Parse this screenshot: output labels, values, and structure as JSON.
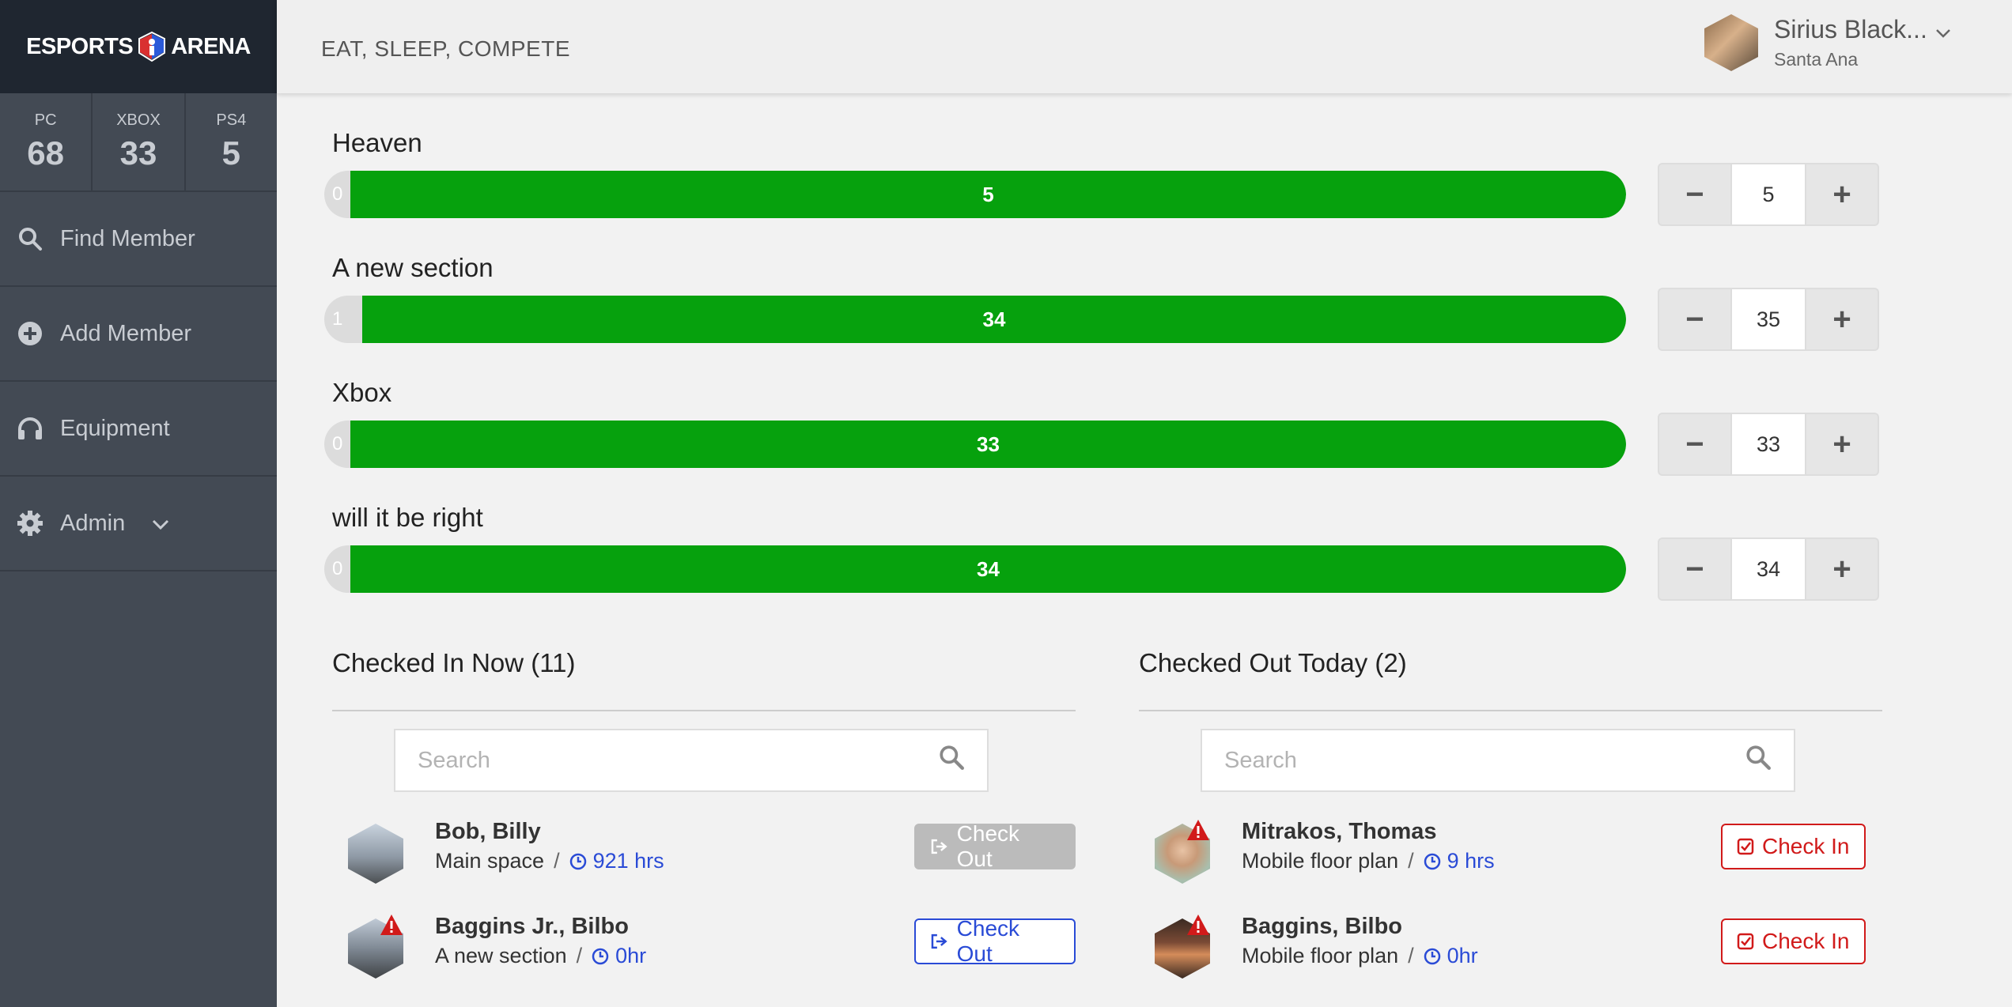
{
  "brand": {
    "left": "ESPORTS",
    "right": "ARENA"
  },
  "stats": [
    {
      "label": "PC",
      "value": "68"
    },
    {
      "label": "XBOX",
      "value": "33"
    },
    {
      "label": "PS4",
      "value": "5"
    }
  ],
  "nav": {
    "find": "Find Member",
    "add": "Add Member",
    "equipment": "Equipment",
    "admin": "Admin"
  },
  "header": {
    "tagline": "EAT, SLEEP, COMPETE",
    "user_name": "Sirius Black...",
    "user_location": "Santa Ana"
  },
  "sections": [
    {
      "title": "Heaven",
      "min": "0",
      "bar_value": "5",
      "count": "5",
      "fill_fraction": 0.98
    },
    {
      "title": "A new section",
      "min": "1",
      "bar_value": "34",
      "count": "35",
      "fill_fraction": 0.971
    },
    {
      "title": "Xbox",
      "min": "0",
      "bar_value": "33",
      "count": "33",
      "fill_fraction": 0.98
    },
    {
      "title": "will it be right",
      "min": "0",
      "bar_value": "34",
      "count": "34",
      "fill_fraction": 0.98
    }
  ],
  "stepper": {
    "minus": "−",
    "plus": "+"
  },
  "checked_in": {
    "title": "Checked In Now (11)",
    "search_placeholder": "Search",
    "rows": [
      {
        "name": "Bob, Billy",
        "location": "Main space",
        "hours": "921 hrs",
        "action": "Check Out"
      },
      {
        "name": "Baggins Jr., Bilbo",
        "location": "A new section",
        "hours": "0hr",
        "action": "Check Out"
      }
    ]
  },
  "checked_out": {
    "title": "Checked Out Today (2)",
    "search_placeholder": "Search",
    "rows": [
      {
        "name": "Mitrakos, Thomas",
        "location": "Mobile floor plan",
        "hours": "9 hrs",
        "action": "Check In"
      },
      {
        "name": "Baggins, Bilbo",
        "location": "Mobile floor plan",
        "hours": "0hr",
        "action": "Check In"
      }
    ]
  },
  "colors": {
    "bar_fill": "#06a10d",
    "sidebar": "#434a54",
    "link_blue": "#2a4bd6",
    "alert_red": "#d11a1a"
  }
}
